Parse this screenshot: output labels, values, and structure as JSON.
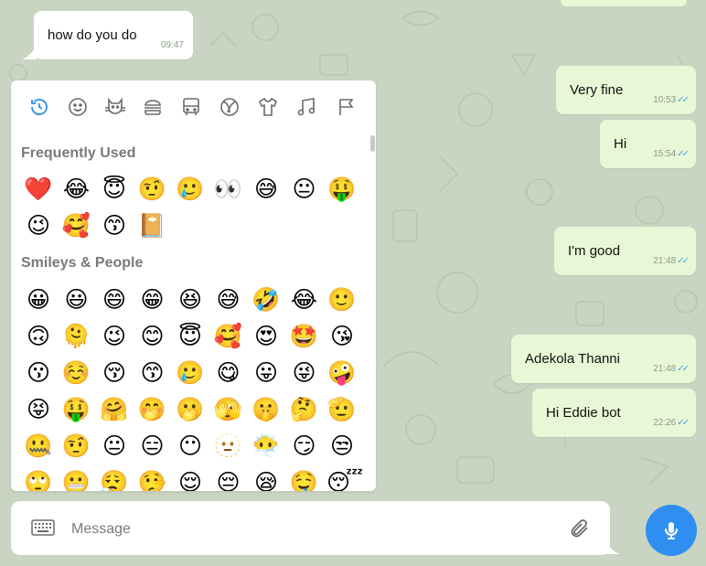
{
  "messages": [
    {
      "side": "in",
      "text": "how do you do",
      "time": "09:47"
    },
    {
      "side": "out",
      "text": "Very fine",
      "time": "10:53"
    },
    {
      "side": "out",
      "text": "Hi",
      "time": "15:54"
    },
    {
      "side": "out",
      "text": "I'm good",
      "time": "21:48"
    },
    {
      "side": "out",
      "text": "Adekola Thanni",
      "time": "21:48"
    },
    {
      "side": "out",
      "text": "Hi Eddie bot",
      "time": "22:26"
    }
  ],
  "emoji_panel": {
    "tabs": [
      "recent-icon",
      "smiley-icon",
      "cat-icon",
      "food-icon",
      "bus-icon",
      "ball-icon",
      "shirt-icon",
      "music-icon",
      "flag-icon"
    ],
    "frequently_used_title": "Frequently Used",
    "frequently_used": [
      "❤️",
      "😂",
      "😇",
      "🤨",
      "🥲",
      "👀",
      "😅",
      "😐",
      "🤑",
      "😉",
      "🥰",
      "😙",
      "📔"
    ],
    "smileys_title": "Smileys & People",
    "smileys": [
      "😀",
      "😃",
      "😄",
      "😁",
      "😆",
      "😅",
      "🤣",
      "😂",
      "🙂",
      "🙃",
      "🫠",
      "😉",
      "😊",
      "😇",
      "🥰",
      "😍",
      "🤩",
      "😘",
      "😗",
      "☺️",
      "😚",
      "😙",
      "🥲",
      "😋",
      "😛",
      "😜",
      "🤪",
      "😝",
      "🤑",
      "🤗",
      "🤭",
      "🫢",
      "🫣",
      "🤫",
      "🤔",
      "🫡",
      "🤐",
      "🤨",
      "😐",
      "😑",
      "😶",
      "🫥",
      "😶‍🌫️",
      "😏",
      "😒",
      "🙄",
      "😬",
      "😮‍💨",
      "🤥",
      "😌",
      "😔",
      "😪",
      "🤤",
      "😴"
    ]
  },
  "composer": {
    "placeholder": "Message"
  },
  "colors": {
    "chat_bg": "#c9d5c2",
    "outgoing_bubble": "#e8f8d6",
    "incoming_bubble": "#ffffff",
    "mic_button": "#2e8ff0",
    "read_tick": "#4aa3e8"
  }
}
